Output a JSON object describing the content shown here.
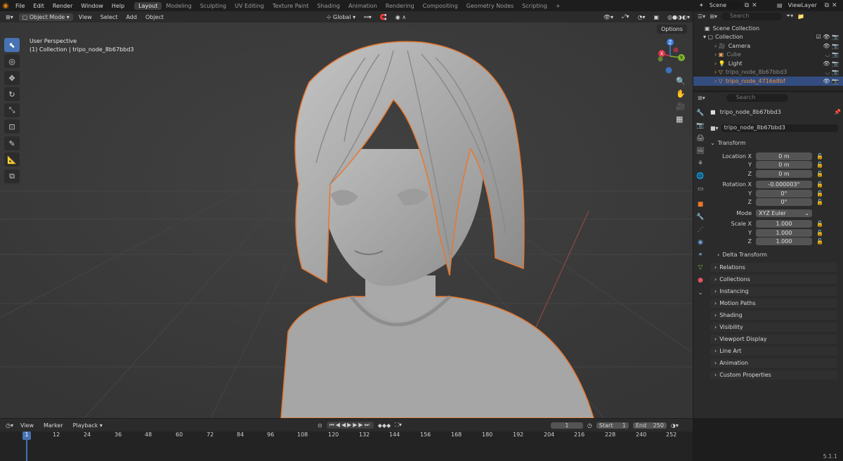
{
  "topbar": {
    "menus": [
      "File",
      "Edit",
      "Render",
      "Window",
      "Help"
    ],
    "workspaces": [
      "Layout",
      "Modeling",
      "Sculpting",
      "UV Editing",
      "Texture Paint",
      "Shading",
      "Animation",
      "Rendering",
      "Compositing",
      "Geometry Nodes",
      "Scripting"
    ],
    "active_workspace": "Layout",
    "scene": "Scene",
    "view_layer": "ViewLayer"
  },
  "viewport_header": {
    "mode": "Object Mode",
    "menus": [
      "View",
      "Select",
      "Add",
      "Object"
    ],
    "transform_orientation": "Global",
    "options": "Options"
  },
  "viewport": {
    "perspective": "User Perspective",
    "collection_info": "(1) Collection | tripo_node_8b67bbd3",
    "gizmo": {
      "z": "Z",
      "x": "X",
      "y": "Y"
    }
  },
  "outliner": {
    "search_placeholder": "Search",
    "root": "Scene Collection",
    "collection": "Collection",
    "items": [
      {
        "name": "Camera",
        "dim": false
      },
      {
        "name": "Cube",
        "dim": true
      },
      {
        "name": "Light",
        "dim": false
      },
      {
        "name": "tripo_node_8b67bbd3",
        "dim": true
      },
      {
        "name": "tripo_node_4716e8bf",
        "dim": false
      }
    ]
  },
  "properties": {
    "search_placeholder": "Search",
    "object_name": "tripo_node_8b67bbd3",
    "object_field": "tripo_node_8b67bbd3",
    "transform_label": "Transform",
    "location_label": "Location X",
    "location": [
      "0 m",
      "0 m",
      "0 m"
    ],
    "rotation_label": "Rotation X",
    "rotation": [
      "-0.000003°",
      "0°",
      "0°"
    ],
    "mode_label": "Mode",
    "mode_value": "XYZ Euler",
    "scale_label": "Scale X",
    "scale": [
      "1.000",
      "1.000",
      "1.000"
    ],
    "axis_y": "Y",
    "axis_z": "Z",
    "delta": "Delta Transform",
    "panels": [
      "Relations",
      "Collections",
      "Instancing",
      "Motion Paths",
      "Shading",
      "Visibility",
      "Viewport Display",
      "Line Art",
      "Animation",
      "Custom Properties"
    ]
  },
  "timeline": {
    "menus": [
      "View",
      "Marker",
      "Playback"
    ],
    "current_frame": "1",
    "start_label": "Start",
    "start": "1",
    "end_label": "End",
    "end": "250",
    "ticks": [
      "1",
      "12",
      "24",
      "36",
      "48",
      "60",
      "72",
      "84",
      "96",
      "108",
      "120",
      "132",
      "144",
      "156",
      "168",
      "180",
      "192",
      "204",
      "216",
      "228",
      "240",
      "252"
    ]
  },
  "status": {
    "version": "5.1.1"
  },
  "colors": {
    "accent": "#4772b3",
    "selection_outline": "#e8772e",
    "x_axis": "#e0344a",
    "y_axis": "#7eb52a",
    "z_axis": "#3d7fdc"
  }
}
